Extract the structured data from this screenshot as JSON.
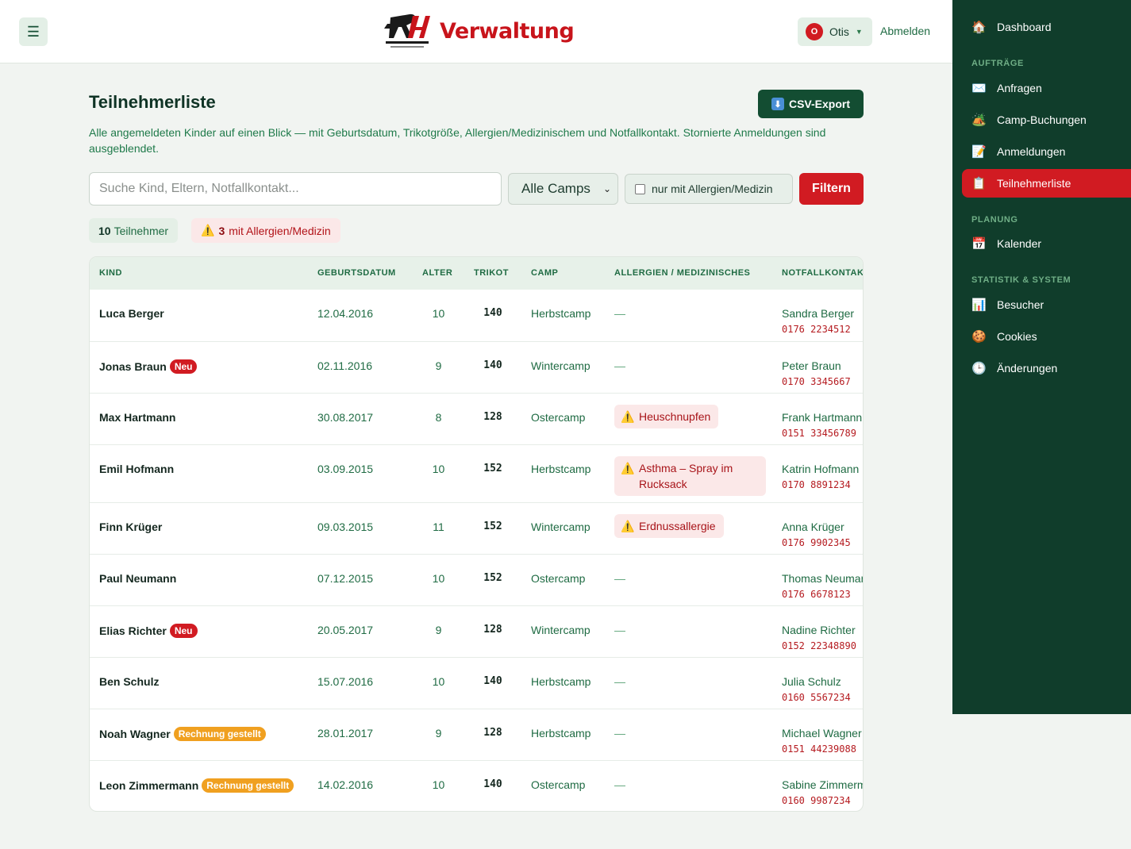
{
  "header": {
    "menu_icon": "☰",
    "brand_title": "Verwaltung",
    "user": {
      "initial": "O",
      "name": "Otis"
    },
    "logout_label": "Abmelden"
  },
  "sidebar": {
    "dashboard": {
      "icon": "🏠",
      "label": "Dashboard"
    },
    "section_auftraege": "AUFTRÄGE",
    "anfragen": {
      "icon": "✉️",
      "label": "Anfragen"
    },
    "camp_buchungen": {
      "icon": "🏕️",
      "label": "Camp-Buchungen"
    },
    "anmeldungen": {
      "icon": "📝",
      "label": "Anmeldungen"
    },
    "teilnehmerliste": {
      "icon": "📋",
      "label": "Teilnehmerliste"
    },
    "section_planung": "PLANUNG",
    "kalender": {
      "icon": "📅",
      "label": "Kalender"
    },
    "section_statistik": "STATISTIK & SYSTEM",
    "besucher": {
      "icon": "📊",
      "label": "Besucher"
    },
    "cookies": {
      "icon": "🍪",
      "label": "Cookies"
    },
    "aenderungen": {
      "icon": "🕒",
      "label": "Änderungen"
    }
  },
  "page": {
    "title": "Teilnehmerliste",
    "csv_icon": "⬇",
    "csv_label": "CSV-Export",
    "description": "Alle angemeldeten Kinder auf einen Blick — mit Geburtsdatum, Trikotgröße, Allergien/Medizinischem und Notfallkontakt. Stornierte Anmeldungen sind ausgeblendet."
  },
  "filters": {
    "search_placeholder": "Suche Kind, Eltern, Notfallkontakt...",
    "camp_selected": "Alle Camps",
    "allergy_only_label": "nur mit Allergien/Medizin",
    "filter_button": "Filtern"
  },
  "stats": {
    "count": "10",
    "count_label": "Teilnehmer",
    "allergy_icon": "⚠️",
    "allergy_count": "3",
    "allergy_label": "mit Allergien/Medizin"
  },
  "table": {
    "headers": {
      "kind": "KIND",
      "dob": "GEBURTSDATUM",
      "age": "ALTER",
      "shirt": "TRIKOT",
      "camp": "CAMP",
      "med": "ALLERGIEN / MEDIZINISCHES",
      "contact": "NOTFALLKONTAKT"
    },
    "warn_icon": "⚠️",
    "rows": [
      {
        "name": "Luca Berger",
        "badge": "",
        "badge_type": "",
        "dob": "12.04.2016",
        "age": "10",
        "shirt": "140",
        "camp": "Herbstcamp",
        "med": "—",
        "contact_name": "Sandra Berger",
        "contact_phone": "0176 2234512"
      },
      {
        "name": "Jonas Braun",
        "badge": "Neu",
        "badge_type": "neu",
        "dob": "02.11.2016",
        "age": "9",
        "shirt": "140",
        "camp": "Wintercamp",
        "med": "—",
        "contact_name": "Peter Braun",
        "contact_phone": "0170 3345667"
      },
      {
        "name": "Max Hartmann",
        "badge": "",
        "badge_type": "",
        "dob": "30.08.2017",
        "age": "8",
        "shirt": "128",
        "camp": "Ostercamp",
        "med": "Heuschnupfen",
        "contact_name": "Frank Hartmann",
        "contact_phone": "0151 33456789"
      },
      {
        "name": "Emil Hofmann",
        "badge": "",
        "badge_type": "",
        "dob": "03.09.2015",
        "age": "10",
        "shirt": "152",
        "camp": "Herbstcamp",
        "med": "Asthma – Spray im Rucksack",
        "contact_name": "Katrin Hofmann",
        "contact_phone": "0170 8891234"
      },
      {
        "name": "Finn Krüger",
        "badge": "",
        "badge_type": "",
        "dob": "09.03.2015",
        "age": "11",
        "shirt": "152",
        "camp": "Wintercamp",
        "med": "Erdnussallergie",
        "contact_name": "Anna Krüger",
        "contact_phone": "0176 9902345"
      },
      {
        "name": "Paul Neumann",
        "badge": "",
        "badge_type": "",
        "dob": "07.12.2015",
        "age": "10",
        "shirt": "152",
        "camp": "Ostercamp",
        "med": "—",
        "contact_name": "Thomas Neumann",
        "contact_phone": "0176 6678123"
      },
      {
        "name": "Elias Richter",
        "badge": "Neu",
        "badge_type": "neu",
        "dob": "20.05.2017",
        "age": "9",
        "shirt": "128",
        "camp": "Wintercamp",
        "med": "—",
        "contact_name": "Nadine Richter",
        "contact_phone": "0152 22348890"
      },
      {
        "name": "Ben Schulz",
        "badge": "",
        "badge_type": "",
        "dob": "15.07.2016",
        "age": "10",
        "shirt": "140",
        "camp": "Herbstcamp",
        "med": "—",
        "contact_name": "Julia Schulz",
        "contact_phone": "0160 5567234"
      },
      {
        "name": "Noah Wagner",
        "badge": "Rechnung gestellt",
        "badge_type": "rg",
        "dob": "28.01.2017",
        "age": "9",
        "shirt": "128",
        "camp": "Herbstcamp",
        "med": "—",
        "contact_name": "Michael Wagner",
        "contact_phone": "0151 44239088"
      },
      {
        "name": "Leon Zimmermann",
        "badge": "Rechnung gestellt",
        "badge_type": "rg",
        "dob": "14.02.2016",
        "age": "10",
        "shirt": "140",
        "camp": "Ostercamp",
        "med": "—",
        "contact_name": "Sabine Zimmermann",
        "contact_phone": "0160 9987234"
      }
    ]
  }
}
